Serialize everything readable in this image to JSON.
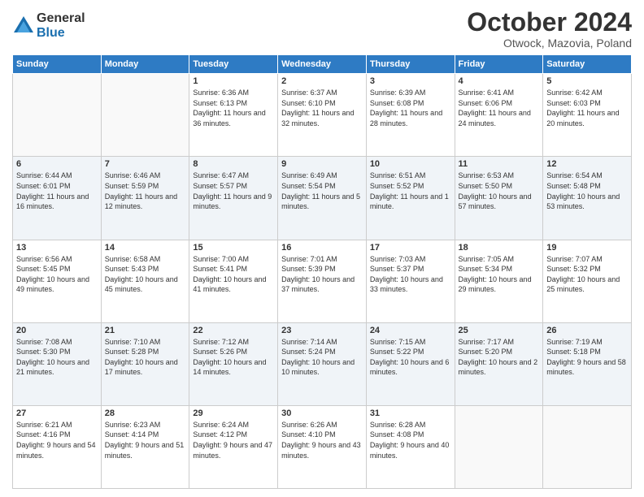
{
  "logo": {
    "general": "General",
    "blue": "Blue"
  },
  "title": "October 2024",
  "subtitle": "Otwock, Mazovia, Poland",
  "days_of_week": [
    "Sunday",
    "Monday",
    "Tuesday",
    "Wednesday",
    "Thursday",
    "Friday",
    "Saturday"
  ],
  "weeks": [
    [
      {
        "day": "",
        "info": ""
      },
      {
        "day": "",
        "info": ""
      },
      {
        "day": "1",
        "info": "Sunrise: 6:36 AM\nSunset: 6:13 PM\nDaylight: 11 hours and 36 minutes."
      },
      {
        "day": "2",
        "info": "Sunrise: 6:37 AM\nSunset: 6:10 PM\nDaylight: 11 hours and 32 minutes."
      },
      {
        "day": "3",
        "info": "Sunrise: 6:39 AM\nSunset: 6:08 PM\nDaylight: 11 hours and 28 minutes."
      },
      {
        "day": "4",
        "info": "Sunrise: 6:41 AM\nSunset: 6:06 PM\nDaylight: 11 hours and 24 minutes."
      },
      {
        "day": "5",
        "info": "Sunrise: 6:42 AM\nSunset: 6:03 PM\nDaylight: 11 hours and 20 minutes."
      }
    ],
    [
      {
        "day": "6",
        "info": "Sunrise: 6:44 AM\nSunset: 6:01 PM\nDaylight: 11 hours and 16 minutes."
      },
      {
        "day": "7",
        "info": "Sunrise: 6:46 AM\nSunset: 5:59 PM\nDaylight: 11 hours and 12 minutes."
      },
      {
        "day": "8",
        "info": "Sunrise: 6:47 AM\nSunset: 5:57 PM\nDaylight: 11 hours and 9 minutes."
      },
      {
        "day": "9",
        "info": "Sunrise: 6:49 AM\nSunset: 5:54 PM\nDaylight: 11 hours and 5 minutes."
      },
      {
        "day": "10",
        "info": "Sunrise: 6:51 AM\nSunset: 5:52 PM\nDaylight: 11 hours and 1 minute."
      },
      {
        "day": "11",
        "info": "Sunrise: 6:53 AM\nSunset: 5:50 PM\nDaylight: 10 hours and 57 minutes."
      },
      {
        "day": "12",
        "info": "Sunrise: 6:54 AM\nSunset: 5:48 PM\nDaylight: 10 hours and 53 minutes."
      }
    ],
    [
      {
        "day": "13",
        "info": "Sunrise: 6:56 AM\nSunset: 5:45 PM\nDaylight: 10 hours and 49 minutes."
      },
      {
        "day": "14",
        "info": "Sunrise: 6:58 AM\nSunset: 5:43 PM\nDaylight: 10 hours and 45 minutes."
      },
      {
        "day": "15",
        "info": "Sunrise: 7:00 AM\nSunset: 5:41 PM\nDaylight: 10 hours and 41 minutes."
      },
      {
        "day": "16",
        "info": "Sunrise: 7:01 AM\nSunset: 5:39 PM\nDaylight: 10 hours and 37 minutes."
      },
      {
        "day": "17",
        "info": "Sunrise: 7:03 AM\nSunset: 5:37 PM\nDaylight: 10 hours and 33 minutes."
      },
      {
        "day": "18",
        "info": "Sunrise: 7:05 AM\nSunset: 5:34 PM\nDaylight: 10 hours and 29 minutes."
      },
      {
        "day": "19",
        "info": "Sunrise: 7:07 AM\nSunset: 5:32 PM\nDaylight: 10 hours and 25 minutes."
      }
    ],
    [
      {
        "day": "20",
        "info": "Sunrise: 7:08 AM\nSunset: 5:30 PM\nDaylight: 10 hours and 21 minutes."
      },
      {
        "day": "21",
        "info": "Sunrise: 7:10 AM\nSunset: 5:28 PM\nDaylight: 10 hours and 17 minutes."
      },
      {
        "day": "22",
        "info": "Sunrise: 7:12 AM\nSunset: 5:26 PM\nDaylight: 10 hours and 14 minutes."
      },
      {
        "day": "23",
        "info": "Sunrise: 7:14 AM\nSunset: 5:24 PM\nDaylight: 10 hours and 10 minutes."
      },
      {
        "day": "24",
        "info": "Sunrise: 7:15 AM\nSunset: 5:22 PM\nDaylight: 10 hours and 6 minutes."
      },
      {
        "day": "25",
        "info": "Sunrise: 7:17 AM\nSunset: 5:20 PM\nDaylight: 10 hours and 2 minutes."
      },
      {
        "day": "26",
        "info": "Sunrise: 7:19 AM\nSunset: 5:18 PM\nDaylight: 9 hours and 58 minutes."
      }
    ],
    [
      {
        "day": "27",
        "info": "Sunrise: 6:21 AM\nSunset: 4:16 PM\nDaylight: 9 hours and 54 minutes."
      },
      {
        "day": "28",
        "info": "Sunrise: 6:23 AM\nSunset: 4:14 PM\nDaylight: 9 hours and 51 minutes."
      },
      {
        "day": "29",
        "info": "Sunrise: 6:24 AM\nSunset: 4:12 PM\nDaylight: 9 hours and 47 minutes."
      },
      {
        "day": "30",
        "info": "Sunrise: 6:26 AM\nSunset: 4:10 PM\nDaylight: 9 hours and 43 minutes."
      },
      {
        "day": "31",
        "info": "Sunrise: 6:28 AM\nSunset: 4:08 PM\nDaylight: 9 hours and 40 minutes."
      },
      {
        "day": "",
        "info": ""
      },
      {
        "day": "",
        "info": ""
      }
    ]
  ]
}
